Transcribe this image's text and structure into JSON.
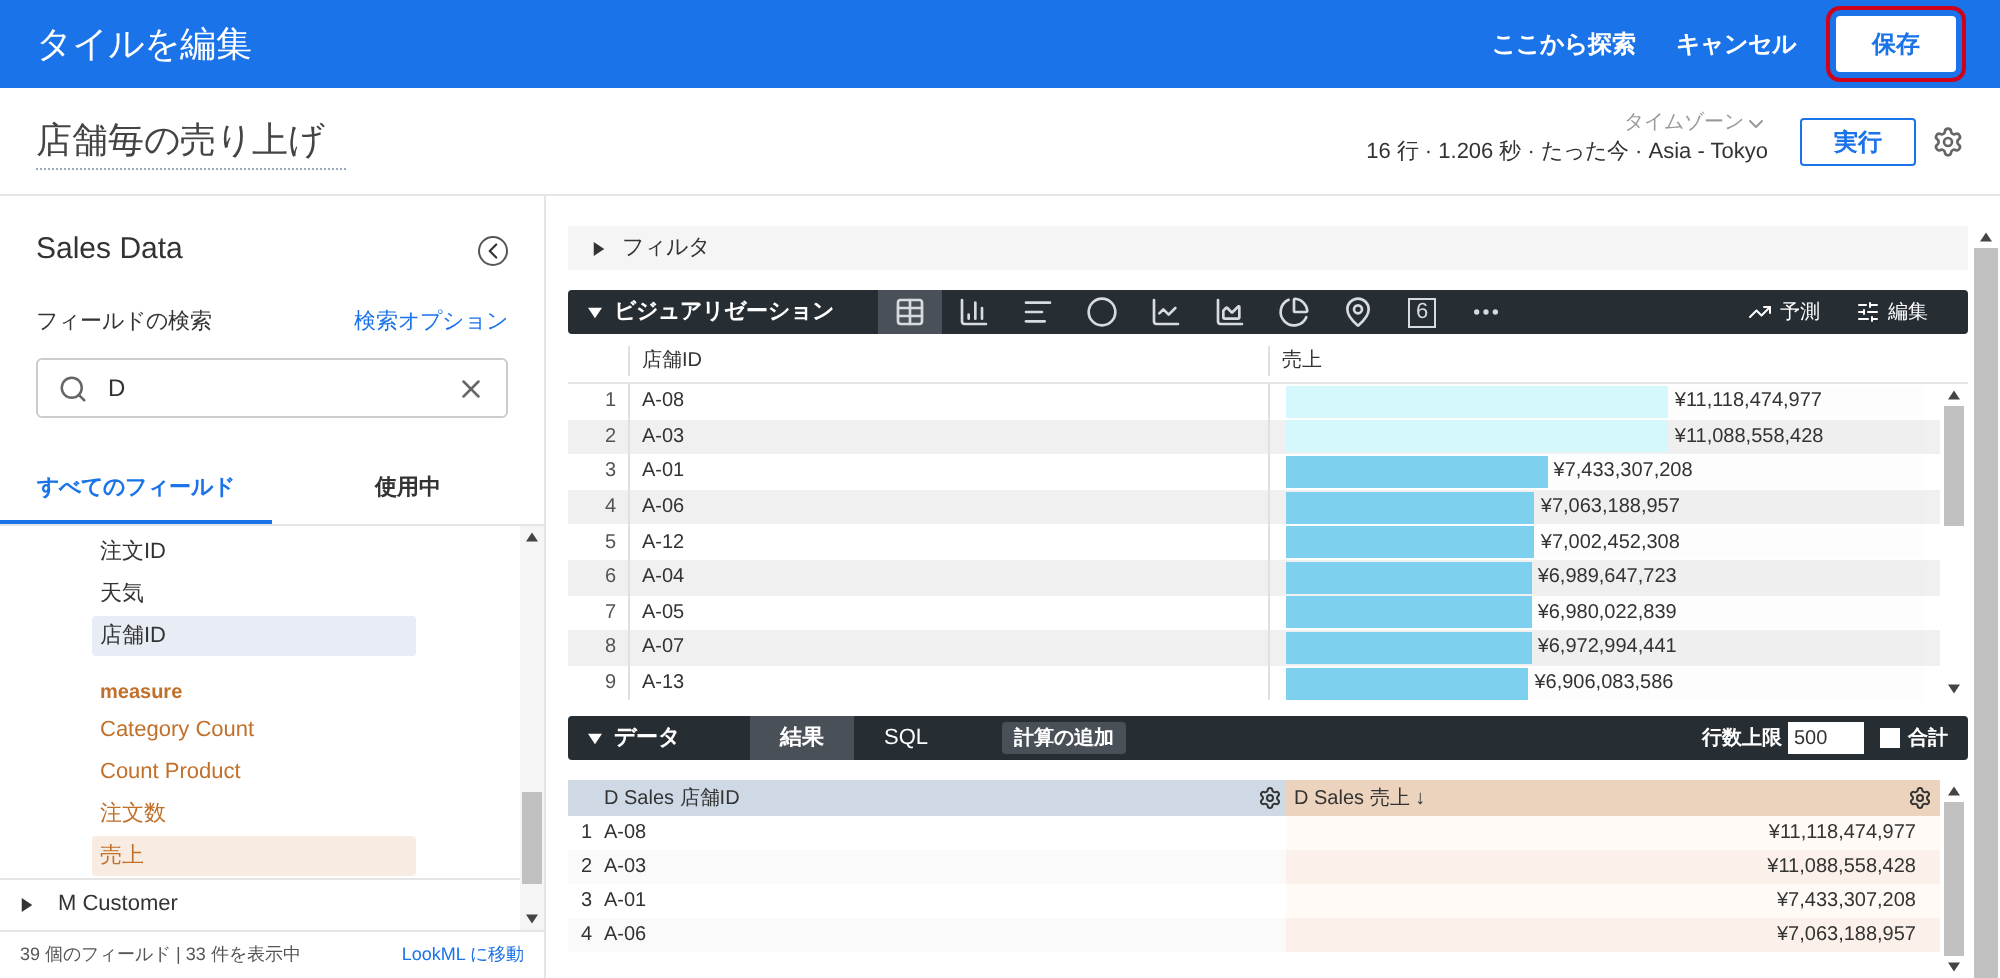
{
  "header": {
    "title": "タイルを編集",
    "links": [
      "ここから探索",
      "キャンセル"
    ],
    "save": "保存"
  },
  "query": {
    "title": "店舗毎の売り上げ",
    "stats": "16 行 · 1.206 秒 · たった今 · Asia - Tokyo",
    "timezone": "タイムゾーン",
    "run": "実行"
  },
  "sidebar": {
    "title": "Sales Data",
    "search_label": "フィールドの検索",
    "search_options": "検索オプション",
    "search_value": "D",
    "tabs": [
      {
        "label": "すべてのフィールド",
        "selected": true
      },
      {
        "label": "使用中",
        "selected": false
      }
    ],
    "fields": [
      {
        "label": "注文ID",
        "kind": "dimension",
        "selected": false
      },
      {
        "label": "天気",
        "kind": "dimension",
        "selected": false
      },
      {
        "label": "店舗ID",
        "kind": "dimension",
        "selected": true
      },
      {
        "label": "measure",
        "kind": "heading"
      },
      {
        "label": "Category Count",
        "kind": "measure",
        "selected": false
      },
      {
        "label": "Count Product",
        "kind": "measure",
        "selected": false
      },
      {
        "label": "注文数",
        "kind": "measure",
        "selected": false
      },
      {
        "label": "売上",
        "kind": "measure",
        "selected": true
      }
    ],
    "groups": [
      {
        "label": "M Customer",
        "expanded": false
      }
    ],
    "footer": "39 個のフィールド | 33 件を表示中",
    "lookml_link": "LookML に移動"
  },
  "filter": {
    "label": "フィルタ",
    "expanded": false
  },
  "visualization": {
    "label": "ビジュアリゼーション",
    "expanded": true,
    "types": [
      {
        "kind": "table",
        "selected": true
      },
      {
        "kind": "column",
        "selected": false
      },
      {
        "kind": "bar",
        "selected": false
      },
      {
        "kind": "scatter",
        "selected": false
      },
      {
        "kind": "line",
        "selected": false
      },
      {
        "kind": "area",
        "selected": false
      },
      {
        "kind": "pie",
        "selected": false
      },
      {
        "kind": "map",
        "selected": false
      },
      {
        "kind": "single",
        "label": "6",
        "selected": false
      },
      {
        "kind": "more",
        "selected": false
      }
    ],
    "forecast": "予測",
    "edit": "編集",
    "columns": [
      "店舗ID",
      "売上"
    ],
    "rows": [
      {
        "num": "1",
        "id": "A-08",
        "value": "¥11,118,474,977",
        "level": 0.6,
        "color": "#d4f8fb"
      },
      {
        "num": "2",
        "id": "A-03",
        "value": "¥11,088,558,428",
        "level": 0.6,
        "color": "#d4f8fb"
      },
      {
        "num": "3",
        "id": "A-01",
        "value": "¥7,433,307,208",
        "level": 0.41,
        "color": "#7dd0ee"
      },
      {
        "num": "4",
        "id": "A-06",
        "value": "¥7,063,188,957",
        "level": 0.39,
        "color": "#7dd0ee"
      },
      {
        "num": "5",
        "id": "A-12",
        "value": "¥7,002,452,308",
        "level": 0.39,
        "color": "#7dd0ee"
      },
      {
        "num": "6",
        "id": "A-04",
        "value": "¥6,989,647,723",
        "level": 0.385,
        "color": "#7dd0ee"
      },
      {
        "num": "7",
        "id": "A-05",
        "value": "¥6,980,022,839",
        "level": 0.385,
        "color": "#7dd0ee"
      },
      {
        "num": "8",
        "id": "A-07",
        "value": "¥6,972,994,441",
        "level": 0.385,
        "color": "#7dd0ee"
      },
      {
        "num": "9",
        "id": "A-13",
        "value": "¥6,906,083,586",
        "level": 0.38,
        "color": "#7dd0ee"
      }
    ]
  },
  "data": {
    "label": "データ",
    "expanded": true,
    "tabs": [
      {
        "label": "結果",
        "selected": true
      },
      {
        "label": "SQL",
        "selected": false
      }
    ],
    "add_calc": "計算の追加",
    "row_limit_label": "行数上限",
    "row_limit": "500",
    "totals_label": "合計",
    "totals": false,
    "columns": [
      "D Sales 店舗ID",
      "D Sales 売上 ↓"
    ],
    "rows": [
      {
        "num": "1",
        "id": "A-08",
        "value": "¥11,118,474,977"
      },
      {
        "num": "2",
        "id": "A-03",
        "value": "¥11,088,558,428"
      },
      {
        "num": "3",
        "id": "A-01",
        "value": "¥7,433,307,208"
      },
      {
        "num": "4",
        "id": "A-06",
        "value": "¥7,063,188,957"
      }
    ]
  }
}
